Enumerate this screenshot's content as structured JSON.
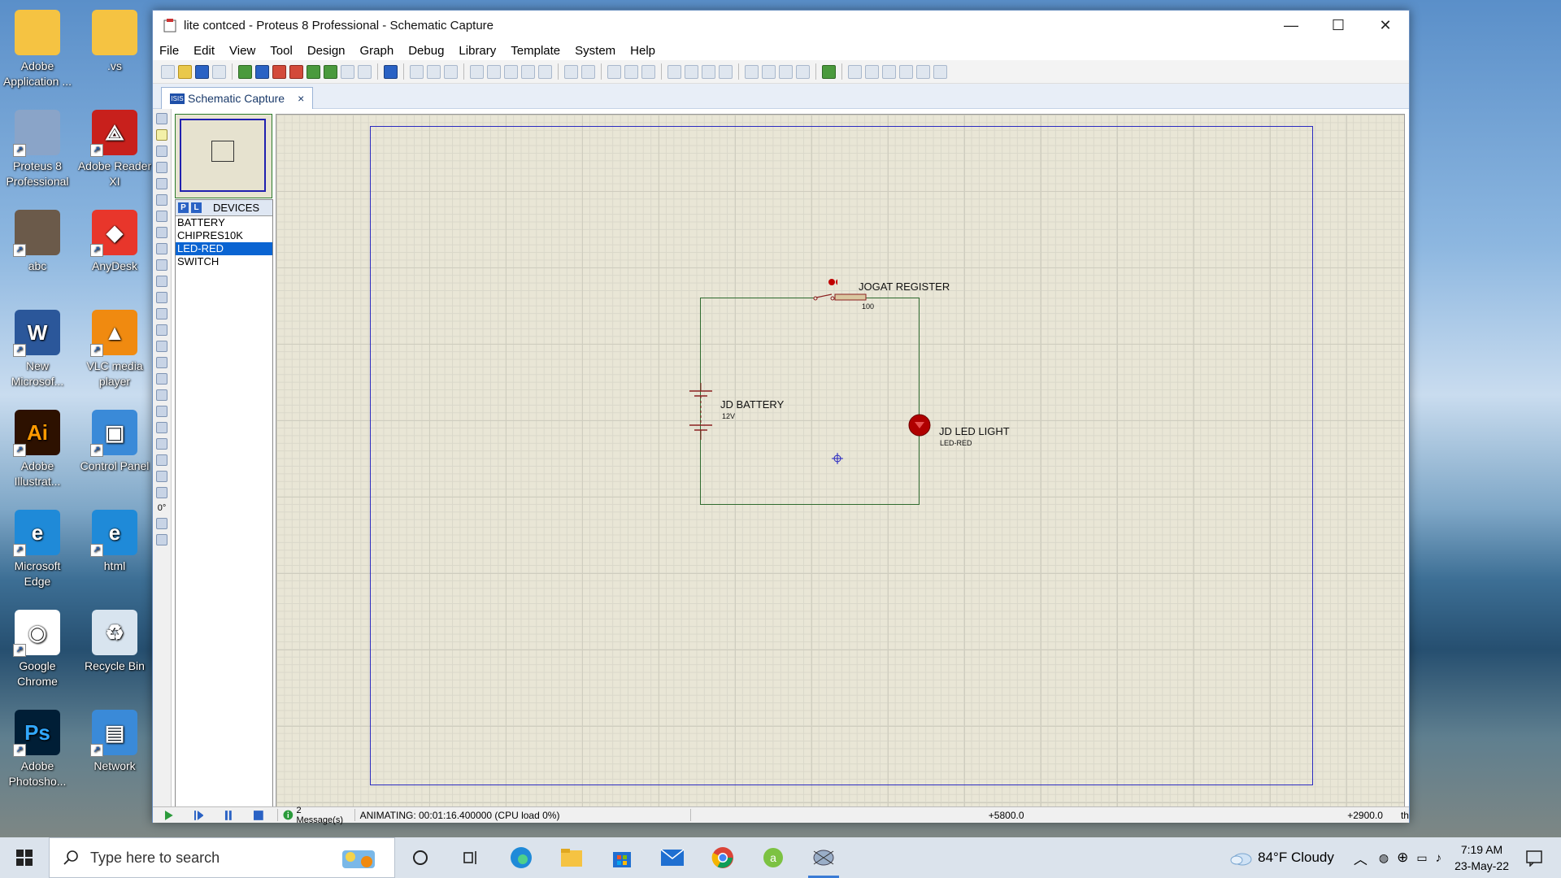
{
  "desktop": {
    "icons": [
      {
        "label": "Adobe Application ...",
        "color": "#f5c342"
      },
      {
        "label": ".vs",
        "color": "#f5c342"
      },
      {
        "label": "Proteus 8 Professional",
        "color": "#8aa4c8"
      },
      {
        "label": "Adobe Reader XI",
        "color": "#c8201c"
      },
      {
        "label": "abc",
        "color": "#6b5a4a"
      },
      {
        "label": "AnyDesk",
        "color": "#e8362b"
      },
      {
        "label": "New Microsof...",
        "color": "#2b579a"
      },
      {
        "label": "VLC media player",
        "color": "#f08a10"
      },
      {
        "label": "Adobe Illustrat...",
        "color": "#2d1100"
      },
      {
        "label": "Control Panel",
        "color": "#3a8ad8"
      },
      {
        "label": "Microsoft Edge",
        "color": "#1f8ad8"
      },
      {
        "label": "html",
        "color": "#1f8ad8"
      },
      {
        "label": "Google Chrome",
        "color": "#ffffff"
      },
      {
        "label": "Recycle Bin",
        "color": "#d8e4ef"
      },
      {
        "label": "Adobe Photosho...",
        "color": "#001e36"
      },
      {
        "label": "Network",
        "color": "#3a8ad8"
      }
    ]
  },
  "window": {
    "title": "lite contced - Proteus 8 Professional - Schematic Capture",
    "minimize": "—",
    "maximize": "☐",
    "close": "✕"
  },
  "menu": [
    "File",
    "Edit",
    "View",
    "Tool",
    "Design",
    "Graph",
    "Debug",
    "Library",
    "Template",
    "System",
    "Help"
  ],
  "tab": {
    "icon": "ISIS",
    "label": "Schematic Capture",
    "close": "×"
  },
  "rotation_label": "0°",
  "devices": {
    "p": "P",
    "l": "L",
    "header": "DEVICES",
    "items": [
      "BATTERY",
      "CHIPRES10K",
      "LED-RED",
      "SWITCH"
    ],
    "selected": "LED-RED"
  },
  "schematic": {
    "resistor_label": "JOGAT REGISTER",
    "resistor_value": "100",
    "battery_label": "JD BATTERY",
    "battery_value": "12V",
    "led_label": "JD LED LIGHT",
    "led_value": "LED-RED",
    "wire_color": "#2f6b2f",
    "led_color": "#b00000"
  },
  "status": {
    "messages": "2 Message(s)",
    "animating": "ANIMATING: 00:01:16.400000 (CPU load 0%)",
    "x_coord": "+5800.0",
    "y_coord": "+2900.0",
    "units": "th"
  },
  "taskbar": {
    "search_placeholder": "Type here to search",
    "weather": "84°F  Cloudy",
    "time": "7:19 AM",
    "date": "23-May-22"
  }
}
